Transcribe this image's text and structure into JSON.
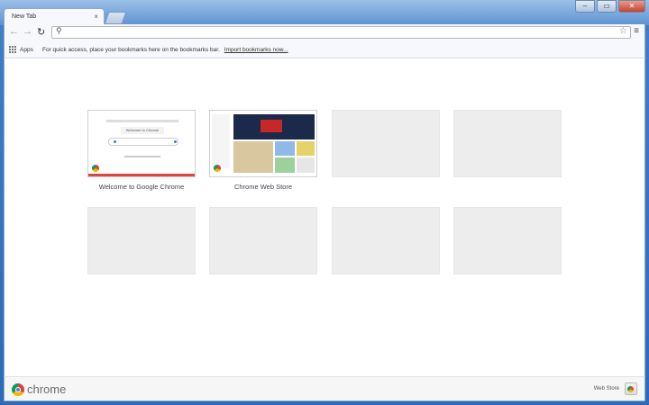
{
  "tab": {
    "title": "New Tab",
    "close": "×"
  },
  "window_controls": {
    "minimize": "–",
    "maximize": "▭",
    "close": "✕"
  },
  "toolbar": {
    "back": "←",
    "forward": "→",
    "reload": "↻",
    "omnibox_value": "",
    "star": "☆",
    "menu": "≡"
  },
  "bookmarks": {
    "apps_label": "Apps",
    "message": "For quick access, place your bookmarks here on the bookmarks bar.",
    "import_link": "Import bookmarks now..."
  },
  "most_visited": [
    {
      "title": "Welcome to Google Chrome",
      "thumb_heading": "Welcome to Chrome"
    },
    {
      "title": "Chrome Web Store"
    },
    {
      "title": ""
    },
    {
      "title": ""
    },
    {
      "title": ""
    },
    {
      "title": ""
    },
    {
      "title": ""
    },
    {
      "title": ""
    }
  ],
  "footer": {
    "brand": "chrome",
    "webstore_label": "Web Store"
  },
  "colors": {
    "frame": "#2a6cb7",
    "accent": "#4285f4"
  }
}
